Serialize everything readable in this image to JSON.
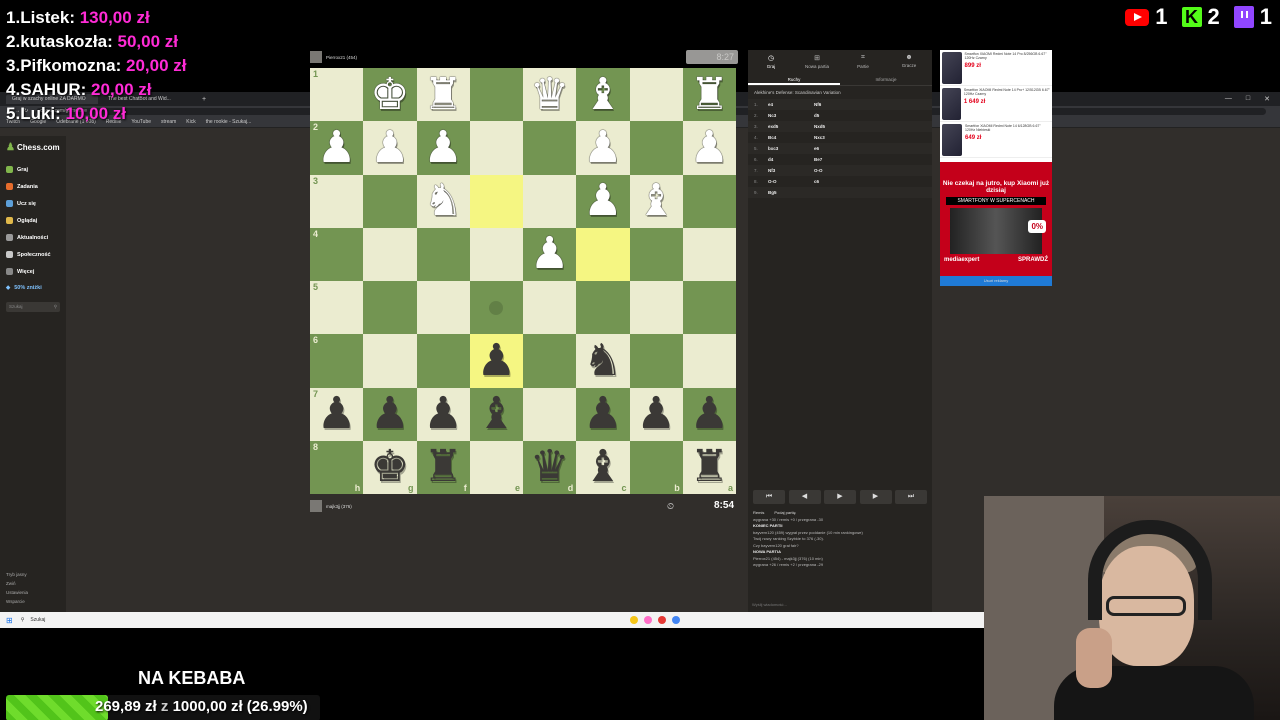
{
  "donations": [
    {
      "rank": "1.",
      "name": "Listek:",
      "amount": "130,00 zł"
    },
    {
      "rank": "2.",
      "name": "kutaskozła:",
      "amount": "50,00 zł"
    },
    {
      "rank": "3.",
      "name": "Pifkomozna:",
      "amount": "20,00 zł"
    },
    {
      "rank": "4.",
      "name": "SAHUR:",
      "amount": "20,00 zł"
    },
    {
      "rank": "5.",
      "name": "Luki:",
      "amount": "10,00 zł"
    }
  ],
  "socials": {
    "youtube": "1",
    "kick": "2",
    "twitch": "1",
    "kick_letter": "K"
  },
  "browser": {
    "tabs": [
      "Graj w szachy online ZA DARMO",
      "The best ChatBot and Wid..."
    ],
    "plus": "+",
    "controls": [
      "—",
      "□",
      "✕"
    ],
    "address": "chess.com/game/live",
    "bookmarks": [
      "Twitch",
      "Google",
      "Odebrane (1 608)",
      "Redfile",
      "YouTube",
      "stream",
      "Kick",
      "the rookie - Szukaj..."
    ]
  },
  "sidebar": {
    "logo": "Chess.com",
    "items": [
      {
        "label": "Graj",
        "color": "#81b64c"
      },
      {
        "label": "Zadania",
        "color": "#e66c2c"
      },
      {
        "label": "Ucz się",
        "color": "#5d9fd8"
      },
      {
        "label": "Oglądaj",
        "color": "#e0b84a"
      },
      {
        "label": "Aktualności",
        "color": "#9a9a9a"
      },
      {
        "label": "Społeczność",
        "color": "#c8c8c8"
      },
      {
        "label": "Więcej",
        "color": "#888"
      }
    ],
    "promo": "50% zniżki",
    "search_placeholder": "Szukaj",
    "bottom": [
      "Tryb jasny",
      "Zwiń",
      "Ustawienia",
      "Wsparcie"
    ]
  },
  "top_player": {
    "name": "Pierrox21 (454)",
    "clock": "8:27"
  },
  "bottom_player": {
    "name": "majk3jj (376)",
    "clock": "8:54",
    "clock_icon": "⏲"
  },
  "board": {
    "rows": [
      [
        {
          "p": "",
          "c": ""
        },
        {
          "p": "♚",
          "c": "w"
        },
        {
          "p": "♜",
          "c": "w"
        },
        {
          "p": "",
          "c": ""
        },
        {
          "p": "♛",
          "c": "w"
        },
        {
          "p": "♝",
          "c": "w"
        },
        {
          "p": "",
          "c": ""
        },
        {
          "p": "♜",
          "c": "w"
        }
      ],
      [
        {
          "p": "♟",
          "c": "w"
        },
        {
          "p": "♟",
          "c": "w"
        },
        {
          "p": "♟",
          "c": "w"
        },
        {
          "p": "",
          "c": ""
        },
        {
          "p": "",
          "c": ""
        },
        {
          "p": "♟",
          "c": "w"
        },
        {
          "p": "",
          "c": ""
        },
        {
          "p": "♟",
          "c": "w"
        }
      ],
      [
        {
          "p": "",
          "c": ""
        },
        {
          "p": "",
          "c": ""
        },
        {
          "p": "♞",
          "c": "w"
        },
        {
          "p": "",
          "c": ""
        },
        {
          "p": "",
          "c": ""
        },
        {
          "p": "♟",
          "c": "w"
        },
        {
          "p": "♝",
          "c": "w"
        },
        {
          "p": "",
          "c": ""
        }
      ],
      [
        {
          "p": "",
          "c": ""
        },
        {
          "p": "",
          "c": ""
        },
        {
          "p": "",
          "c": ""
        },
        {
          "p": "",
          "c": ""
        },
        {
          "p": "♟",
          "c": "w"
        },
        {
          "p": "",
          "c": ""
        },
        {
          "p": "",
          "c": ""
        },
        {
          "p": "",
          "c": ""
        }
      ],
      [
        {
          "p": "",
          "c": ""
        },
        {
          "p": "",
          "c": ""
        },
        {
          "p": "",
          "c": ""
        },
        {
          "p": "",
          "c": ""
        },
        {
          "p": "",
          "c": ""
        },
        {
          "p": "",
          "c": ""
        },
        {
          "p": "",
          "c": ""
        },
        {
          "p": "",
          "c": ""
        }
      ],
      [
        {
          "p": "",
          "c": ""
        },
        {
          "p": "",
          "c": ""
        },
        {
          "p": "",
          "c": ""
        },
        {
          "p": "♟",
          "c": "b"
        },
        {
          "p": "",
          "c": ""
        },
        {
          "p": "♞",
          "c": "b"
        },
        {
          "p": "",
          "c": ""
        },
        {
          "p": "",
          "c": ""
        }
      ],
      [
        {
          "p": "♟",
          "c": "b"
        },
        {
          "p": "♟",
          "c": "b"
        },
        {
          "p": "♟",
          "c": "b"
        },
        {
          "p": "♝",
          "c": "b"
        },
        {
          "p": "",
          "c": ""
        },
        {
          "p": "♟",
          "c": "b"
        },
        {
          "p": "♟",
          "c": "b"
        },
        {
          "p": "♟",
          "c": "b"
        }
      ],
      [
        {
          "p": "",
          "c": ""
        },
        {
          "p": "♚",
          "c": "b"
        },
        {
          "p": "♜",
          "c": "b"
        },
        {
          "p": "",
          "c": ""
        },
        {
          "p": "♛",
          "c": "b"
        },
        {
          "p": "♝",
          "c": "b"
        },
        {
          "p": "",
          "c": ""
        },
        {
          "p": "♜",
          "c": "b"
        }
      ]
    ],
    "rank_labels": [
      "1",
      "2",
      "3",
      "4",
      "5",
      "6",
      "7",
      "8"
    ],
    "file_labels": [
      "h",
      "g",
      "f",
      "e",
      "d",
      "c",
      "b",
      "a"
    ]
  },
  "panel": {
    "tabs": [
      {
        "icon": "◷",
        "label": "Graj"
      },
      {
        "icon": "⊞",
        "label": "Nowa partia"
      },
      {
        "icon": "⌗",
        "label": "Partie"
      },
      {
        "icon": "☻",
        "label": "Gracze"
      }
    ],
    "subtabs": [
      "Ruchy",
      "Informacje"
    ],
    "opening": "Alekhine's Defense: Scandinavian Variation",
    "moves": [
      {
        "n": "1.",
        "w": "e4",
        "b": "Nf6"
      },
      {
        "n": "2.",
        "w": "Nc3",
        "b": "d5"
      },
      {
        "n": "3.",
        "w": "exd5",
        "b": "Nxd5"
      },
      {
        "n": "4.",
        "w": "Bc4",
        "b": "Nxc3"
      },
      {
        "n": "5.",
        "w": "bxc3",
        "b": "e6"
      },
      {
        "n": "6.",
        "w": "d4",
        "b": "Be7"
      },
      {
        "n": "7.",
        "w": "Nf3",
        "b": "O-O"
      },
      {
        "n": "8.",
        "w": "O-O",
        "b": "c6"
      },
      {
        "n": "9.",
        "w": "Bg5",
        "b": ""
      }
    ],
    "nav": [
      "⏮",
      "◀",
      "▶",
      "▶",
      "⏭"
    ],
    "remis": "Remis",
    "share": "Podaj partię",
    "result_line": "wygrana +30 / remis +0 / przegrana -30"
  },
  "chat": {
    "end_title": "KONIEC PARTII",
    "end_line1": "bayvern120 (459) wygrał przez poddanie (10 min rankingowe)",
    "end_line2": "Twój nowy ranking Szybkie to 376 (-30).",
    "prompt": "Czy bayvern120 grał fair?",
    "new_title": "NOWA PARTIA",
    "new_line1": "Pierrox21 (454) - majk3jj (376) (10 min)",
    "new_line2": "wygrana +26 / remis +2 / przegrana -29",
    "input_placeholder": "Wyślij wiadomość..."
  },
  "ad": {
    "items": [
      {
        "text": "Smartfon XIAOMI Redmi Note 14 Pro 8/256GB 6.67\" 120Hz Czarny",
        "price": "899 zł"
      },
      {
        "text": "Smartfon XIAOMI Redmi Note 14 Pro+ 12/512GB 6.67\" 120Hz Czarny",
        "price": "1 649 zł"
      },
      {
        "text": "Smartfon XIAOMI Redmi Note 14 6/128GB 6.67\" 120Hz Niebieski",
        "price": "649 zł"
      }
    ],
    "headline": "Nie czekaj na jutro, kup Xiaomi już dzisiaj",
    "sub": "SMARTFONY W SUPERCENACH",
    "badge": "0%",
    "brand": "mediaexpert",
    "cta": "SPRAWDŹ",
    "bar": "Usuń reklamy"
  },
  "taskbar": {
    "search": "Szukaj"
  },
  "goal": {
    "title": "NA KEBABA",
    "current": "269,89 zł",
    "sep": "z",
    "target": "1000,00 zł",
    "percent": "(26.99%)",
    "progress": 0.2699
  }
}
